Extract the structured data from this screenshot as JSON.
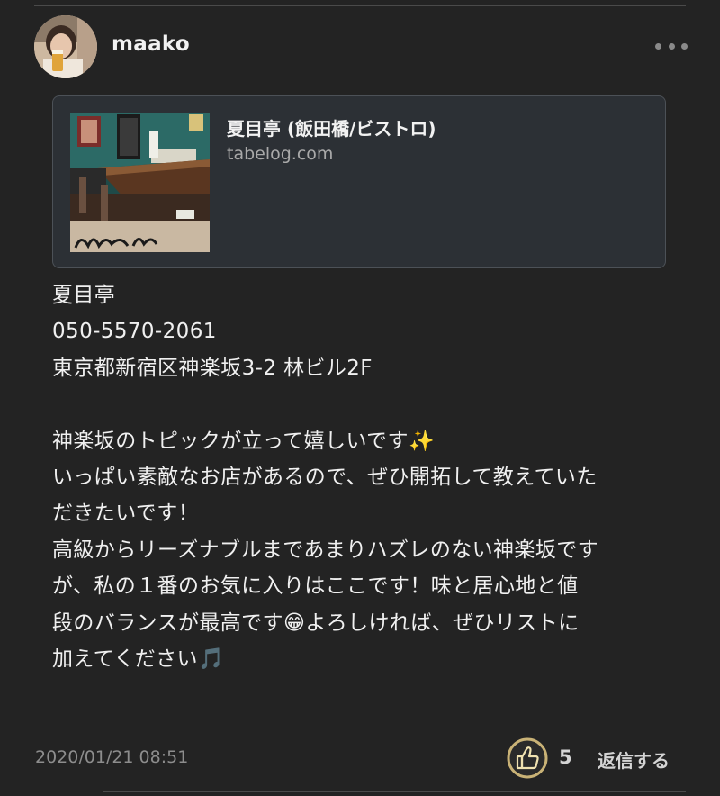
{
  "post": {
    "username": "maako",
    "link_card": {
      "title": "夏目亭 (飯田橋/ビストロ)",
      "domain": "tabelog.com"
    },
    "body_lines": [
      "夏目亭",
      "050-5570-2061",
      "東京都新宿区神楽坂3-2 林ビル2F",
      "",
      "神楽坂のトピックが立って嬉しいです✨",
      "いっぱい素敵なお店があるので、ぜひ開拓して教えていた",
      "だきたいです！",
      "高級からリーズナブルまであまりハズレのない神楽坂です",
      "が、私の１番のお気に入りはここです！味と居心地と値",
      "段のバランスが最高です😁よろしければ、ぜひリストに",
      "加えてください🎵"
    ],
    "timestamp": "2020/01/21 08:51",
    "like_count": "5",
    "reply_label": "返信する"
  },
  "icons": {
    "more": "more-horizontal-icon",
    "like": "thumbs-up-icon"
  },
  "colors": {
    "background": "#232323",
    "card_background": "#2c3035",
    "like_ring": "#c9b276",
    "muted_text": "#8d8d8d"
  }
}
